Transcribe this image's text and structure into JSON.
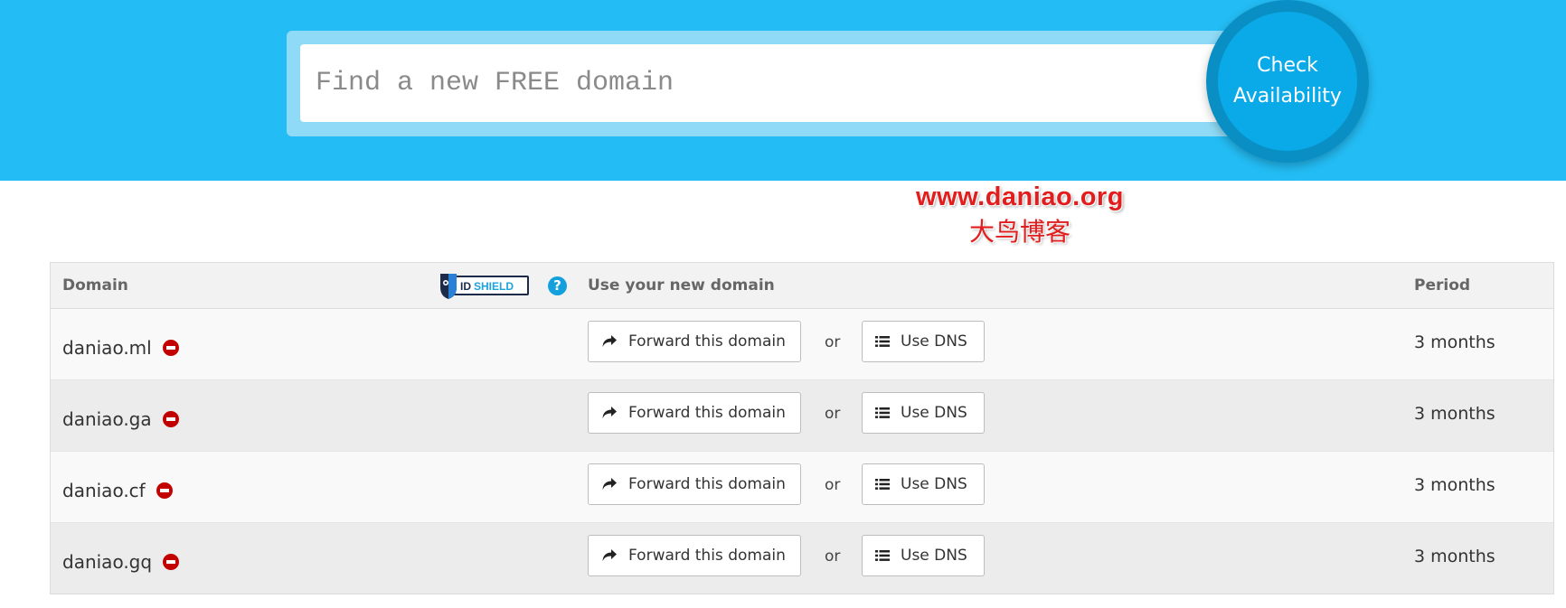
{
  "search": {
    "placeholder": "Find a new FREE domain",
    "value": "",
    "check_button_line1": "Check",
    "check_button_line2": "Availability"
  },
  "watermark": {
    "line1": "www.daniao.org",
    "line2": "大鸟博客"
  },
  "table": {
    "headers": {
      "domain": "Domain",
      "use": "Use your new domain",
      "period": "Period"
    },
    "idshield_logo_text": "IDSHIELD",
    "help_icon": "?",
    "rows": [
      {
        "domain": "daniao.ml",
        "forward_label": "Forward this domain",
        "or_label": "or",
        "dns_label": "Use DNS",
        "period": "3 months"
      },
      {
        "domain": "daniao.ga",
        "forward_label": "Forward this domain",
        "or_label": "or",
        "dns_label": "Use DNS",
        "period": "3 months"
      },
      {
        "domain": "daniao.cf",
        "forward_label": "Forward this domain",
        "or_label": "or",
        "dns_label": "Use DNS",
        "period": "3 months"
      },
      {
        "domain": "daniao.gq",
        "forward_label": "Forward this domain",
        "or_label": "or",
        "dns_label": "Use DNS",
        "period": "3 months"
      }
    ]
  },
  "colors": {
    "hero_background": "#23bcf4",
    "check_button": "#0aaae8",
    "remove_icon": "#c30000",
    "watermark": "#e11d1d"
  },
  "icons": {
    "remove": "minus-circle-icon",
    "forward": "share-arrow-icon",
    "dns": "list-icon",
    "help": "question-circle-icon"
  }
}
